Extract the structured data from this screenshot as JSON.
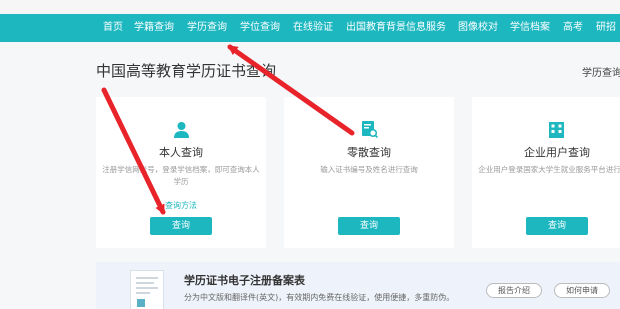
{
  "nav": {
    "items": [
      "首页",
      "学籍查询",
      "学历查询",
      "学位查询",
      "在线验证",
      "出国教育背景信息服务",
      "图像校对",
      "学信档案",
      "高考",
      "研招"
    ]
  },
  "page": {
    "title": "中国高等教育学历证书查询",
    "breadcrumb": "学历查询"
  },
  "cards": [
    {
      "title": "本人查询",
      "desc": "注册学信网账号，登录学信档案，即可查询本人学历",
      "link": "查询方法",
      "button": "查询",
      "icon": "user-icon"
    },
    {
      "title": "零散查询",
      "desc": "输入证书编号及姓名进行查询",
      "button": "查询",
      "icon": "document-search-icon"
    },
    {
      "title": "企业用户查询",
      "desc": "企业用户登录国家大学生就业服务平台进行查询",
      "button": "查询",
      "icon": "building-icon"
    }
  ],
  "registration": {
    "title": "学历证书电子注册备案表",
    "desc": "分为中文版和翻译件(英文)，有效期内免费在线验证，使用便捷，多重防伪。",
    "buttons": [
      "报告介绍",
      "如何申请"
    ]
  },
  "colors": {
    "accent": "#1db7c0",
    "annotation_arrow": "#e8232a"
  }
}
